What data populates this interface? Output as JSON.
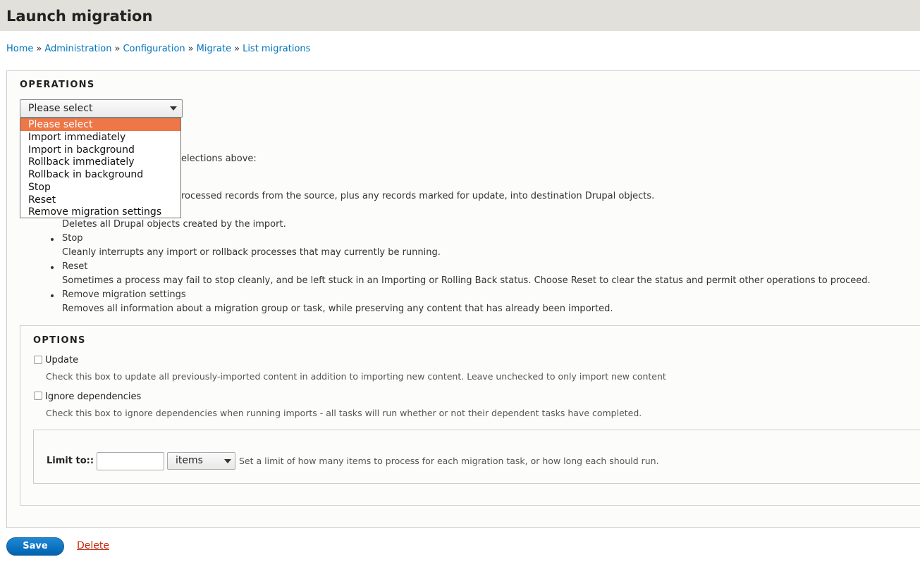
{
  "page": {
    "title": "Launch migration"
  },
  "breadcrumb": [
    {
      "label": "Home"
    },
    {
      "label": "Administration"
    },
    {
      "label": "Configuration"
    },
    {
      "label": "Migrate"
    },
    {
      "label": "List migrations"
    }
  ],
  "breadcrumb_separator": "»",
  "operations": {
    "legend": "OPERATIONS",
    "select_value": "Please select",
    "options": [
      "Please select",
      "Import immediately",
      "Import in background",
      "Rollback immediately",
      "Rollback in background",
      "Stop",
      "Reset",
      "Remove migration settings"
    ],
    "intro_visible": "elections above:",
    "import_desc_visible": "rocessed records from the source, plus any records marked for update, into destination Drupal objects.",
    "rollback_desc": "Deletes all Drupal objects created by the import.",
    "items": [
      {
        "name": "Stop",
        "desc": "Cleanly interrupts any import or rollback processes that may currently be running."
      },
      {
        "name": "Reset",
        "desc": "Sometimes a process may fail to stop cleanly, and be left stuck in an Importing or Rolling Back status. Choose Reset to clear the status and permit other operations to proceed."
      },
      {
        "name": "Remove migration settings",
        "desc": "Removes all information about a migration group or task, while preserving any content that has already been imported."
      }
    ]
  },
  "options": {
    "legend": "OPTIONS",
    "update_label": "Update",
    "update_checked": false,
    "update_help": "Check this box to update all previously-imported content in addition to importing new content. Leave unchecked to only import new content",
    "ignore_label": "Ignore dependencies",
    "ignore_checked": false,
    "ignore_help": "Check this box to ignore dependencies when running imports - all tasks will run whether or not their dependent tasks have completed.",
    "limit_label": "Limit to::",
    "limit_value": "",
    "limit_unit": "items",
    "limit_help": "Set a limit of how many items to process for each migration task, or how long each should run."
  },
  "actions": {
    "save_label": "Save",
    "delete_label": "Delete"
  },
  "colors": {
    "link": "#0074bd",
    "selected_option": "#ee7647",
    "save_button": "#0071c2",
    "delete_link": "#c4250c",
    "header_bg": "#e1e0da"
  }
}
